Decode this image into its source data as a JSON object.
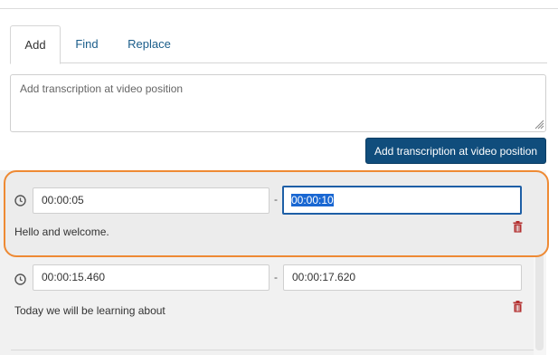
{
  "tabs": [
    {
      "label": "Add",
      "active": true
    },
    {
      "label": "Find",
      "active": false
    },
    {
      "label": "Replace",
      "active": false
    }
  ],
  "new_transcription": {
    "placeholder": "Add transcription at video position",
    "value": ""
  },
  "add_button": {
    "label": "Add transcription at video position"
  },
  "entries": [
    {
      "start": "00:00:05",
      "end": "00:00:10",
      "text": "Hello and welcome.",
      "highlighted": true,
      "end_selected": true
    },
    {
      "start": "00:00:15.460",
      "end": "00:00:17.620",
      "text": "Today we will be learning about",
      "highlighted": false
    }
  ],
  "separator": "-",
  "icons": {
    "time": "clock-icon",
    "delete": "trash-icon",
    "scroll": "chevron-up-icon",
    "resize": "resize-grip-icon"
  },
  "colors": {
    "primary_button": "#104d7c",
    "highlight_outline": "#ee8a34",
    "focus_border": "#1e5fa6",
    "delete_icon": "#b32f2f",
    "tab_link": "#1a5d8a"
  }
}
